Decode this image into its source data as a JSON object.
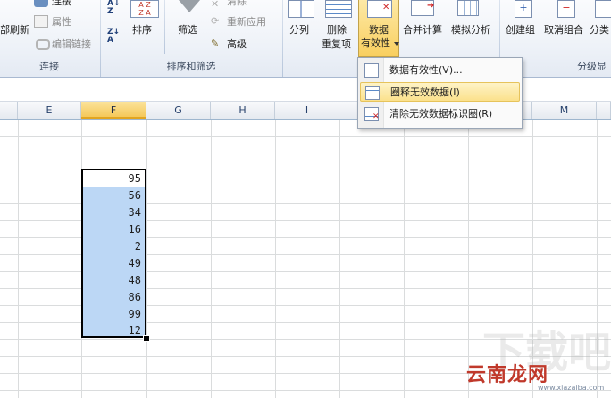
{
  "ribbon": {
    "connections_group": {
      "refresh_all": "部刷新",
      "connections": "连接",
      "properties": "属性",
      "edit_links": "编辑链接",
      "label": "连接"
    },
    "sort_filter_group": {
      "sort": "排序",
      "filter": "筛选",
      "clear": "清除",
      "reapply": "重新应用",
      "advanced": "高级",
      "label": "排序和筛选"
    },
    "data_tools_group": {
      "text_to_columns": "分列",
      "remove_dup_1": "删除",
      "remove_dup_2": "重复项",
      "data_validation_1": "数据",
      "data_validation_2": "有效性",
      "consolidate": "合并计算",
      "what_if": "模拟分析"
    },
    "outline_group": {
      "group": "创建组",
      "ungroup": "取消组合",
      "subtotal": "分类",
      "label": "分级显"
    }
  },
  "dropdown": {
    "items": [
      {
        "label": "数据有效性(V)...",
        "icon": "data-validation-icon"
      },
      {
        "label": "圈释无效数据(I)",
        "icon": "circle-invalid-icon"
      },
      {
        "label": "清除无效数据标识圈(R)",
        "icon": "clear-circles-icon"
      }
    ]
  },
  "columns": [
    "E",
    "F",
    "G",
    "H",
    "I",
    "",
    "",
    "",
    "M"
  ],
  "selected_column": "F",
  "cells": [
    "95",
    "56",
    "34",
    "16",
    "2",
    "49",
    "48",
    "86",
    "99",
    "12"
  ],
  "watermark": {
    "text": "云南龙网",
    "sub": "www.xiazaiba.com",
    "bg": "下载吧"
  },
  "colors": {
    "selection_fill": "#bcd7f5",
    "active_button": "#f9cf5f",
    "ribbon_bg": "#eef2f8"
  }
}
